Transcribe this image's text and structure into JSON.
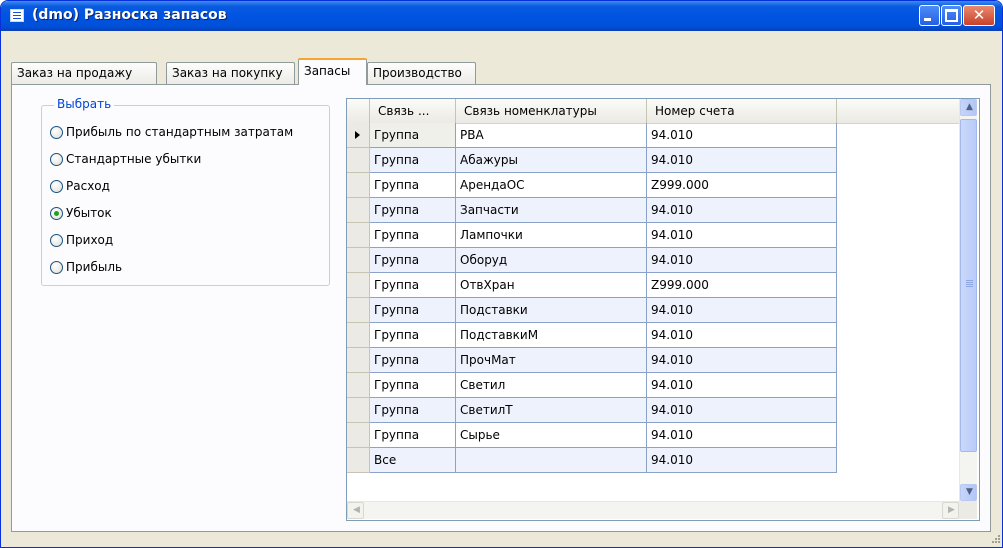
{
  "window": {
    "title": "(dmo) Разноска запасов"
  },
  "tabs": [
    {
      "label": "Заказ на продажу"
    },
    {
      "label": "Заказ на покупку"
    },
    {
      "label": "Запасы"
    },
    {
      "label": "Производство"
    }
  ],
  "active_tab": "Запасы",
  "select_group": {
    "legend": "Выбрать",
    "options": [
      {
        "label": "Прибыль по стандартным затратам",
        "checked": false
      },
      {
        "label": "Стандартные убытки",
        "checked": false
      },
      {
        "label": "Расход",
        "checked": false
      },
      {
        "label": "Убыток",
        "checked": true
      },
      {
        "label": "Приход",
        "checked": false
      },
      {
        "label": "Прибыль",
        "checked": false
      }
    ]
  },
  "grid": {
    "columns": [
      "Связь ...",
      "Связь номенклатуры",
      "Номер счета"
    ],
    "rows": [
      [
        "Группа",
        "PBA",
        "94.010"
      ],
      [
        "Группа",
        "Абажуры",
        "94.010"
      ],
      [
        "Группа",
        "АрендаОС",
        "Z999.000"
      ],
      [
        "Группа",
        "Запчасти",
        "94.010"
      ],
      [
        "Группа",
        "Лампочки",
        "94.010"
      ],
      [
        "Группа",
        "Оборуд",
        "94.010"
      ],
      [
        "Группа",
        "ОтвХран",
        "Z999.000"
      ],
      [
        "Группа",
        "Подставки",
        "94.010"
      ],
      [
        "Группа",
        "ПодставкиМ",
        "94.010"
      ],
      [
        "Группа",
        "ПрочМат",
        "94.010"
      ],
      [
        "Группа",
        "Светил",
        "94.010"
      ],
      [
        "Группа",
        "СветилТ",
        "94.010"
      ],
      [
        "Группа",
        "Сырье",
        "94.010"
      ],
      [
        "Все",
        "",
        "94.010"
      ]
    ],
    "current_row": 0
  }
}
